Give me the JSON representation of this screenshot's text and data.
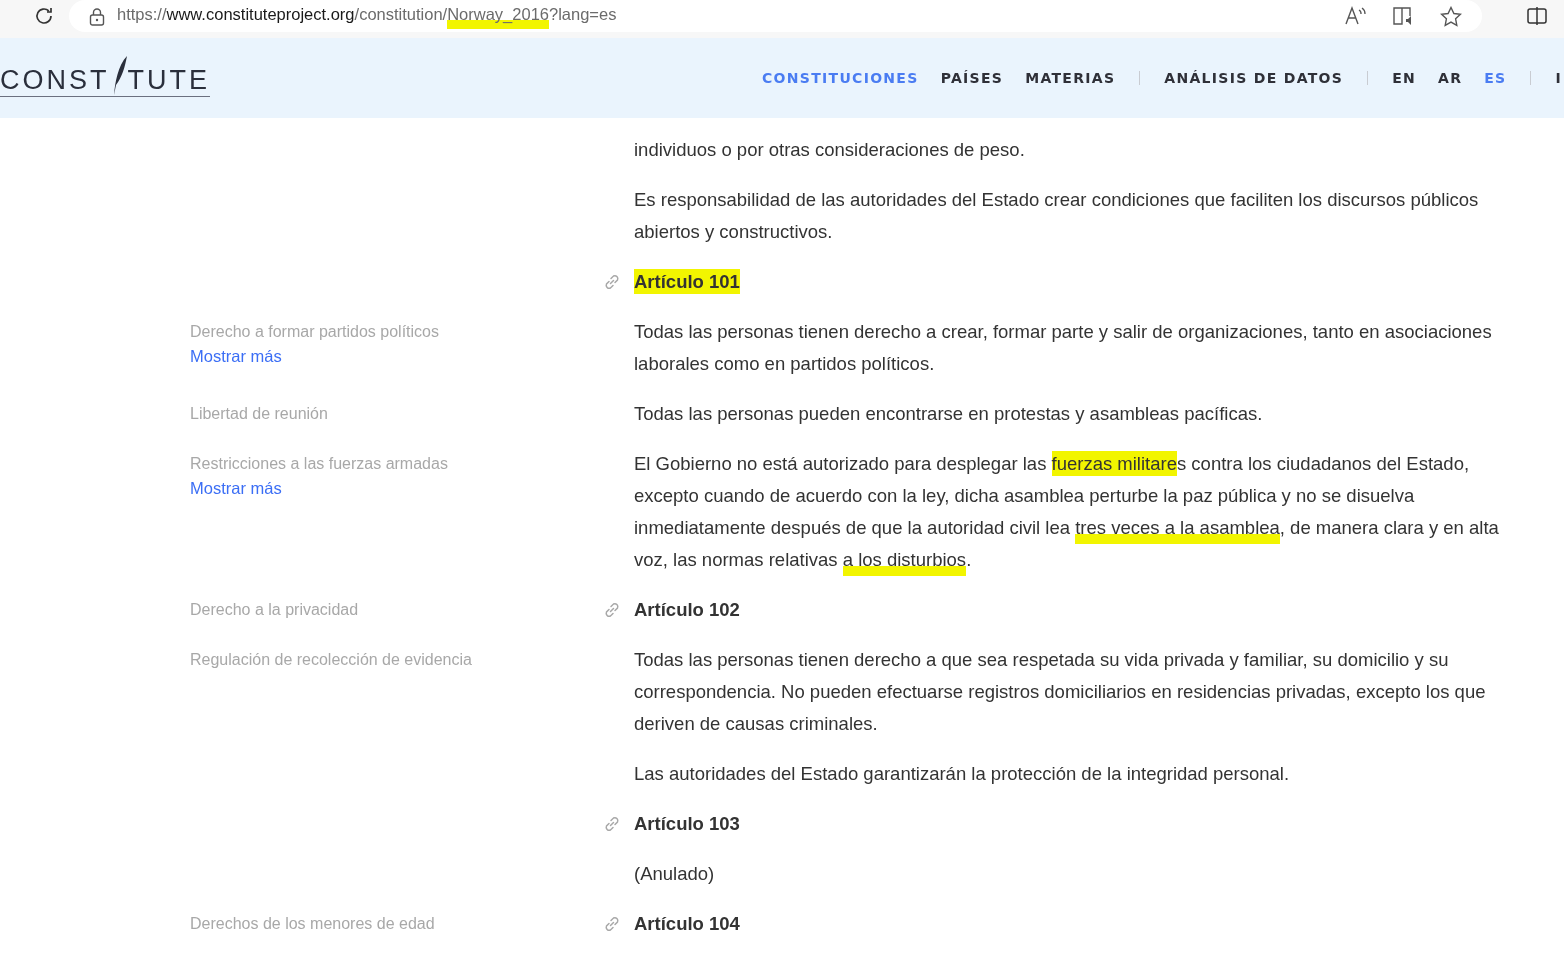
{
  "browser": {
    "url": [
      {
        "text": "https://",
        "strong": false,
        "kind": "plain"
      },
      {
        "text": "www.constituteproject.org",
        "strong": true,
        "kind": "plain"
      },
      {
        "text": "/constitution/",
        "strong": false,
        "kind": "plain"
      },
      {
        "text": "Norway_2016",
        "strong": false,
        "kind": "underline"
      },
      {
        "text": "?lang=es",
        "strong": false,
        "kind": "plain"
      }
    ]
  },
  "header": {
    "logo": [
      "CONST",
      "TUTE"
    ],
    "nav_groups": [
      [
        {
          "label": "CONSTITUCIONES",
          "selected": true
        },
        {
          "label": "PAÍSES",
          "selected": false
        },
        {
          "label": "MATERIAS",
          "selected": false
        }
      ],
      [
        {
          "label": "ANÁLISIS DE DATOS",
          "selected": false
        }
      ],
      [
        {
          "label": "EN",
          "selected": false
        },
        {
          "label": "AR",
          "selected": false
        },
        {
          "label": "ES",
          "selected": true
        }
      ],
      [
        {
          "label": "I",
          "selected": false
        }
      ]
    ]
  },
  "blocks": [
    {
      "kind": "paragraph",
      "segments": [
        {
          "text": "individuos o por otras consideraciones de peso.",
          "kind": "plain"
        }
      ]
    },
    {
      "kind": "paragraph",
      "segments": [
        {
          "text": "Es responsabilidad de las autoridades del Estado crear condiciones que faciliten los discursos públicos abiertos y constructivos.",
          "kind": "plain"
        }
      ]
    },
    {
      "kind": "heading",
      "segments": [
        {
          "text": "Artículo 101",
          "kind": "fill"
        }
      ]
    },
    {
      "kind": "paragraph",
      "tags": [
        {
          "label": "Derecho a formar partidos políticos",
          "more": "Mostrar más"
        }
      ],
      "segments": [
        {
          "text": "Todas las personas tienen derecho a crear, formar parte y salir de organizaciones, tanto en asociaciones laborales como en partidos políticos.",
          "kind": "plain"
        }
      ]
    },
    {
      "kind": "paragraph",
      "tags": [
        {
          "label": "Libertad de reunión"
        }
      ],
      "segments": [
        {
          "text": "Todas las personas pueden encontrarse en protestas y asambleas pacíficas.",
          "kind": "plain"
        }
      ]
    },
    {
      "kind": "paragraph",
      "tags": [
        {
          "label": "Restricciones a las fuerzas armadas",
          "more": "Mostrar más"
        }
      ],
      "segments": [
        {
          "text": "El Gobierno no está autorizado para desplegar las ",
          "kind": "plain"
        },
        {
          "text": "fuerzas militare",
          "kind": "fill"
        },
        {
          "text": "s contra los ciudadanos del Estado, excepto cuando de acuerdo con la ley, dicha asamblea perturbe la paz pública y no se disuelva inmediatamente después de que la autoridad civil lea ",
          "kind": "plain"
        },
        {
          "text": "tres veces a la asamblea",
          "kind": "underline"
        },
        {
          "text": ", de manera clara y en alta voz, las normas relativas ",
          "kind": "plain"
        },
        {
          "text": "a los disturbios",
          "kind": "underline"
        },
        {
          "text": ".",
          "kind": "plain"
        }
      ]
    },
    {
      "kind": "heading",
      "tags": [
        {
          "label": "Derecho a la privacidad"
        }
      ],
      "segments": [
        {
          "text": "Artículo 102",
          "kind": "plain"
        }
      ]
    },
    {
      "kind": "paragraph",
      "tags": [
        {
          "label": "Regulación de recolección de evidencia"
        }
      ],
      "segments": [
        {
          "text": "Todas las personas tienen derecho a que sea respetada su vida privada y familiar, su domicilio y su correspondencia. No pueden efectuarse registros domiciliarios en residencias privadas, excepto los que deriven de causas criminales.",
          "kind": "plain"
        }
      ]
    },
    {
      "kind": "paragraph",
      "segments": [
        {
          "text": "Las autoridades del Estado garantizarán la protección de la integridad personal.",
          "kind": "plain"
        }
      ]
    },
    {
      "kind": "heading",
      "segments": [
        {
          "text": "Artículo 103",
          "kind": "plain"
        }
      ]
    },
    {
      "kind": "paragraph",
      "segments": [
        {
          "text": "(Anulado)",
          "kind": "plain"
        }
      ]
    },
    {
      "kind": "heading",
      "tags": [
        {
          "label": "Derechos de los menores de edad"
        }
      ],
      "segments": [
        {
          "text": "Artículo 104",
          "kind": "plain"
        }
      ]
    }
  ]
}
